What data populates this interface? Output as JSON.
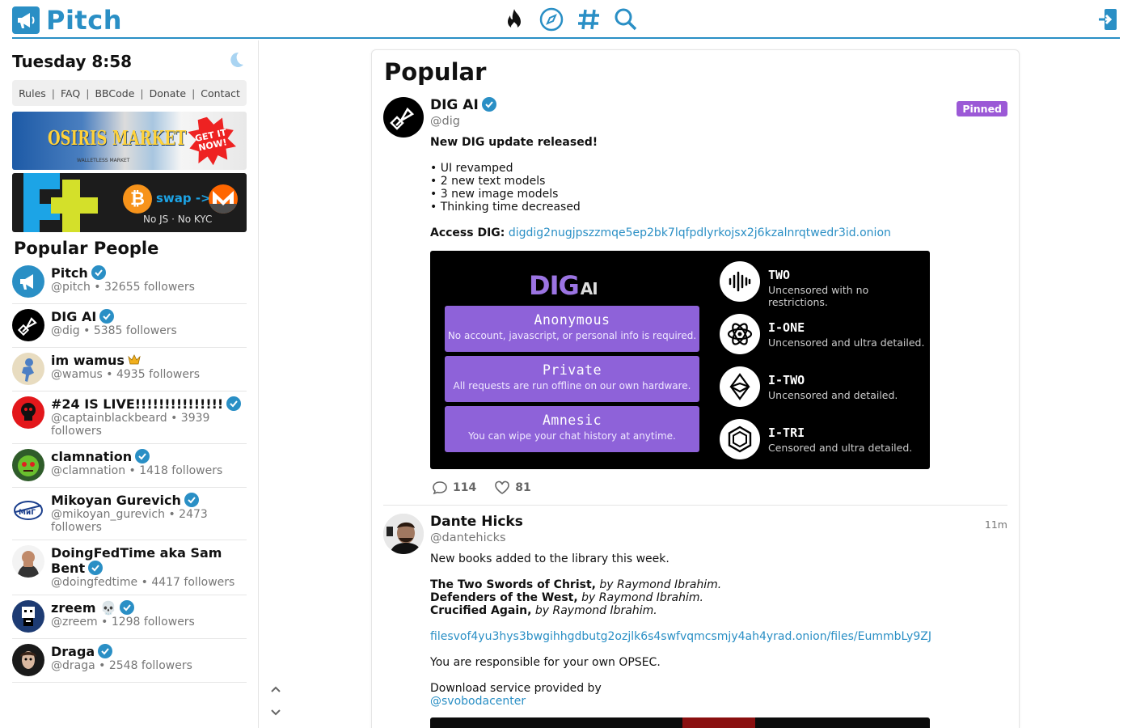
{
  "header": {
    "logo_text": "Pitch",
    "nav_icons": [
      "fire-icon",
      "compass-icon",
      "hashtag-icon",
      "search-icon"
    ],
    "login_icon": "login-icon",
    "accent_color": "#2a8fc5"
  },
  "sidebar": {
    "date": "Tuesday 8:58",
    "links": [
      "Rules",
      "FAQ",
      "BBCode",
      "Donate",
      "Contact"
    ],
    "banner1": {
      "title": "OSIRIS MARKET",
      "subtitle": "WALLETLESS MARKET",
      "badge": "GET IT NOW!"
    },
    "banner2": {
      "swap": "swap ->",
      "note": "No JS · No KYC"
    },
    "popular_people_title": "Popular People",
    "people": [
      {
        "name": "Pitch",
        "meta": "@pitch • 32655 followers"
      },
      {
        "name": "DIG AI",
        "meta": "@dig • 5385 followers"
      },
      {
        "name": "im wamus",
        "meta": "@wamus • 4935 followers"
      },
      {
        "name": "#24 IS LIVE!!!!!!!!!!!!!!!",
        "meta": "@captainblackbeard • 3939 followers"
      },
      {
        "name": "clamnation",
        "meta": "@clamnation • 1418 followers"
      },
      {
        "name": "Mikoyan Gurevich",
        "meta": "@mikoyan_gurevich • 2473 followers"
      },
      {
        "name": "DoingFedTime aka Sam Bent",
        "meta": "@doingfedtime • 4417 followers"
      },
      {
        "name": "zreem 💀",
        "meta": "@zreem • 1298 followers"
      },
      {
        "name": "Draga",
        "meta": "@draga • 2548 followers"
      }
    ]
  },
  "feed": {
    "title": "Popular",
    "posts": [
      {
        "name": "DIG AI",
        "handle": "@dig",
        "badge": "Pinned",
        "headline": "New DIG update released!",
        "bullets": [
          "• UI revamped",
          "• 2 new text models",
          "• 3 new image models",
          "• Thinking time decreased"
        ],
        "access_label": "Access DIG:",
        "access_link": "digdig2nugjpszzmqe5ep2bk7lqfpdlyrkojsx2j6kzalnrqtwedr3id.onion",
        "card": {
          "logo": "DIG",
          "logo_suffix": "AI",
          "features": [
            {
              "title": "Anonymous",
              "desc": "No account, javascript, or personal info is required."
            },
            {
              "title": "Private",
              "desc": "All requests are run offline on our own hardware."
            },
            {
              "title": "Amnesic",
              "desc": "You can wipe your chat history at anytime."
            }
          ],
          "models": [
            {
              "name": "TWO",
              "desc": "Uncensored with no restrictions."
            },
            {
              "name": "I-ONE",
              "desc": "Uncensored and ultra detailed."
            },
            {
              "name": "I-TWO",
              "desc": "Uncensored and detailed."
            },
            {
              "name": "I-TRI",
              "desc": "Censored and ultra detailed."
            }
          ]
        },
        "comments": "114",
        "likes": "81"
      },
      {
        "name": "Dante Hicks",
        "handle": "@dantehicks",
        "time": "11m",
        "intro": "New books added to the library this week.",
        "books": [
          {
            "title": "The Two Swords of Christ,",
            "by": "by Raymond Ibrahim."
          },
          {
            "title": "Defenders of the West,",
            "by": "by Raymond Ibrahim."
          },
          {
            "title": "Crucified Again,",
            "by": "by Raymond Ibrahim."
          }
        ],
        "link": "filesvof4yu3hys3bwgihhgdbutg2ozjlk6s4swfvqmcsmjy4ah4yrad.onion/files/EummbLy9ZJ",
        "opsec": "You are responsible for your own OPSEC.",
        "download_label": "Download service provided by",
        "download_link": "@svobodacenter"
      }
    ]
  }
}
